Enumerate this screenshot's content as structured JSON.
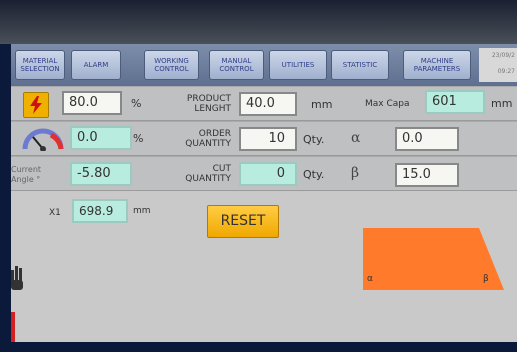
{
  "nav": {
    "material_selection": "MATERIAL\nSELECTION",
    "alarm": "ALARM",
    "working_control": "WORKING\nCONTROL",
    "manual_control": "MANUAL\nCONTROL",
    "utilities": "UTILITIES",
    "statistic": "STATISTIC",
    "machine_parameters": "MACHINE\nPARAMETERS",
    "date": "23/09/2",
    "time": "09:27"
  },
  "row1": {
    "power_value": "80.0",
    "power_unit": "%",
    "product_length_label": "PRODUCT\nLENGHT",
    "product_length_value": "40.0",
    "product_length_unit": "mm",
    "max_capacity_label": "Max Capa",
    "max_capacity_value": "601",
    "max_capacity_unit": "mm"
  },
  "row2": {
    "speed_value": "0.0",
    "speed_unit": "%",
    "order_quantity_label": "ORDER\nQUANTITY",
    "order_quantity_value": "10",
    "order_quantity_unit": "Qty.",
    "alpha_symbol": "α",
    "alpha_value": "0.0"
  },
  "row3": {
    "current_angle_label": "Current\nAngle °",
    "current_angle_value": "-5.80",
    "cut_quantity_label": "CUT\nQUANTITY",
    "cut_quantity_value": "0",
    "cut_quantity_unit": "Qty.",
    "beta_symbol": "β",
    "beta_value": "15.0"
  },
  "row4": {
    "x1_label": "X1",
    "x1_value": "698.9",
    "x1_unit": "mm"
  },
  "reset_label": "RESET",
  "shape": {
    "alpha_label": "α",
    "beta_label": "β",
    "color": "#ff7a2a"
  },
  "colors": {
    "accent_yellow": "#f0b000",
    "cyan_field": "#b8ecdf",
    "nav_bg": "#6f7f9f"
  }
}
